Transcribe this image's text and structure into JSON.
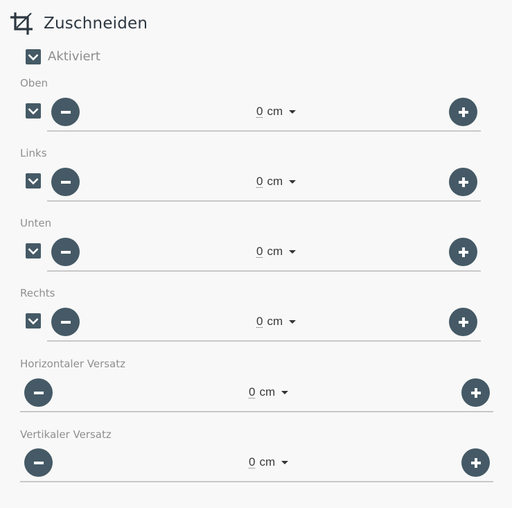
{
  "header": {
    "title": "Zuschneiden",
    "icon": "crop-icon"
  },
  "enabled": {
    "label": "Aktiviert",
    "checked": true
  },
  "rows": [
    {
      "label": "Oben",
      "checked": true,
      "value": "0",
      "unit": "cm"
    },
    {
      "label": "Links",
      "checked": true,
      "value": "0",
      "unit": "cm"
    },
    {
      "label": "Unten",
      "checked": true,
      "value": "0",
      "unit": "cm"
    },
    {
      "label": "Rechts",
      "checked": true,
      "value": "0",
      "unit": "cm"
    },
    {
      "label": "Horizontaler Versatz",
      "value": "0",
      "unit": "cm"
    },
    {
      "label": "Vertikaler Versatz",
      "value": "0",
      "unit": "cm"
    }
  ],
  "colors": {
    "accent": "#455a66",
    "background": "#f8f8f8",
    "label": "#8f8f8f"
  }
}
